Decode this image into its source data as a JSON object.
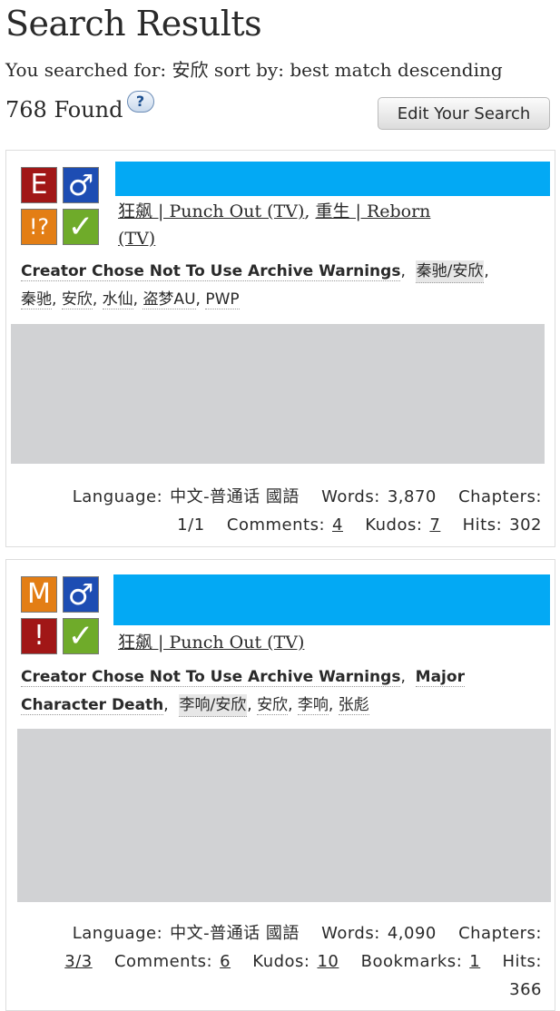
{
  "header": {
    "title": "Search Results",
    "query_line": "You searched for: 安欣 sort by: best match descending",
    "found": "768 Found",
    "help": "?",
    "edit_button": "Edit Your Search"
  },
  "works": [
    {
      "icons": {
        "rating": "E",
        "category": "♂",
        "warning": "!?",
        "complete": "✓"
      },
      "fandoms": [
        "狂飙 | Punch Out (TV)",
        "重生 | Reborn",
        "(TV)"
      ],
      "warnings": [
        "Creator Chose Not To Use Archive Warnings"
      ],
      "relationships": [
        "秦驰/安欣"
      ],
      "tags": [
        "秦驰",
        "安欣",
        "水仙",
        "盗梦AU",
        "PWP"
      ],
      "stats": {
        "language_label": "Language:",
        "language": "中文-普通话 國語",
        "words_label": "Words:",
        "words": "3,870",
        "chapters_label": "Chapters:",
        "chapters": "1/1",
        "comments_label": "Comments:",
        "comments": "4",
        "kudos_label": "Kudos:",
        "kudos": "7",
        "hits_label": "Hits:",
        "hits": "302"
      }
    },
    {
      "icons": {
        "rating": "M",
        "category": "♂",
        "warning": "!",
        "complete": "✓"
      },
      "fandoms": [
        "狂飙 | Punch Out (TV)"
      ],
      "warnings": [
        "Creator Chose Not To Use Archive Warnings",
        "Major",
        "Character Death"
      ],
      "relationships": [
        "李响/安欣"
      ],
      "tags": [
        "安欣",
        "李响",
        "张彪"
      ],
      "stats": {
        "language_label": "Language:",
        "language": "中文-普通话 國語",
        "words_label": "Words:",
        "words": "4,090",
        "chapters_label": "Chapters:",
        "chapters": "3/3",
        "comments_label": "Comments:",
        "comments": "6",
        "kudos_label": "Kudos:",
        "kudos": "10",
        "bookmarks_label": "Bookmarks:",
        "bookmarks": "1",
        "hits_label": "Hits:",
        "hits": "366"
      }
    }
  ],
  "colors": {
    "title_bar": "#03a9f4",
    "summary_placeholder": "#d1d2d4"
  }
}
